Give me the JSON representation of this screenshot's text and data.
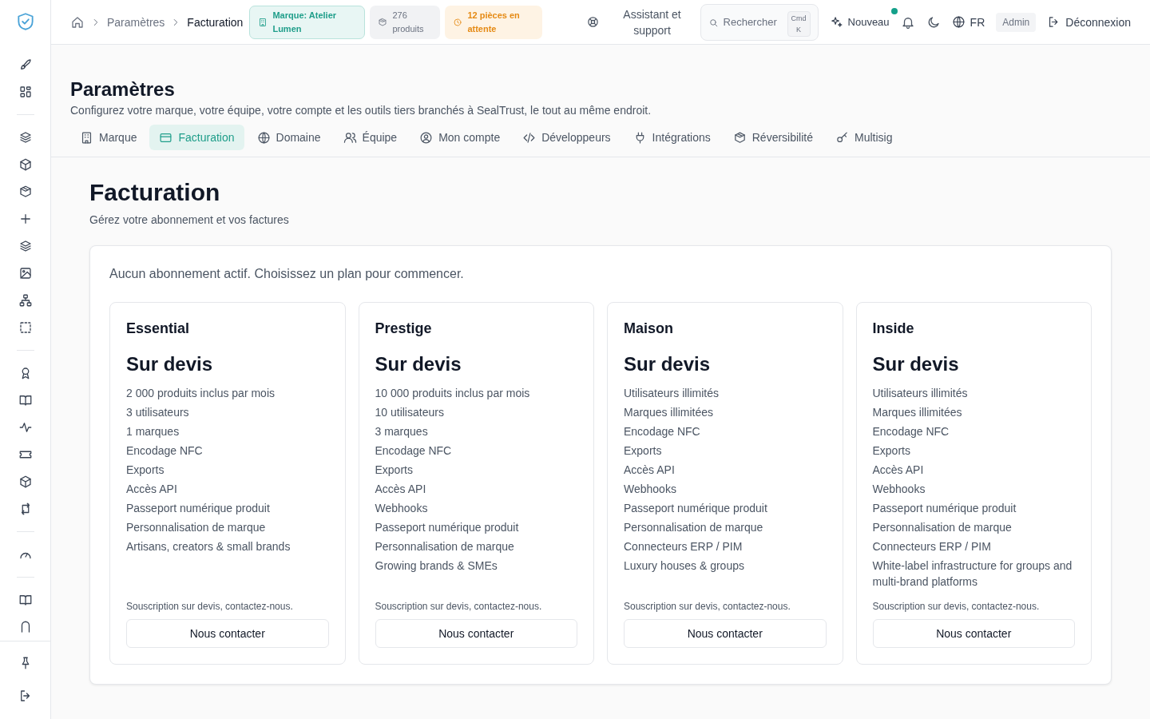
{
  "topbar": {
    "breadcrumbs": [
      "Paramètres",
      "Facturation"
    ],
    "badges": [
      {
        "kind": "brand",
        "text": "Marque: Atelier Lumen"
      },
      {
        "kind": "count",
        "text": "276 produits"
      },
      {
        "kind": "pending",
        "text": "12 pièces en attente"
      }
    ],
    "help": "Assistant et support",
    "search": {
      "placeholder": "Rechercher",
      "shortcut": [
        "Cmd",
        "K"
      ]
    },
    "new_button": {
      "label": "Nouveau",
      "has_update": true
    },
    "language": "FR",
    "role": "Admin",
    "logout": "Déconnexion"
  },
  "page": {
    "title": "Paramètres",
    "subtitle": "Configurez votre marque, votre équipe, votre compte et les outils tiers branchés à SealTrust, le tout au même endroit.",
    "tabs": [
      {
        "label": "Marque",
        "selected": false
      },
      {
        "label": "Facturation",
        "selected": true
      },
      {
        "label": "Domaine",
        "selected": false
      },
      {
        "label": "Équipe",
        "selected": false
      },
      {
        "label": "Mon compte",
        "selected": false
      },
      {
        "label": "Développeurs",
        "selected": false
      },
      {
        "label": "Intégrations",
        "selected": false
      },
      {
        "label": "Réversibilité",
        "selected": false
      },
      {
        "label": "Multisig",
        "selected": false
      }
    ]
  },
  "billing": {
    "title": "Facturation",
    "subtitle": "Gérez votre abonnement et vos factures",
    "notice": "Aucun abonnement actif. Choisissez un plan pour commencer.",
    "plans": [
      {
        "name": "Essential",
        "price": "Sur devis",
        "features": [
          "2 000 produits inclus par mois",
          "3 utilisateurs",
          "1 marques",
          "Encodage NFC",
          "Exports",
          "Accès API",
          "Passeport numérique produit",
          "Personnalisation de marque",
          "Artisans, creators & small brands"
        ],
        "note": "Souscription sur devis, contactez-nous.",
        "button": "Nous contacter"
      },
      {
        "name": "Prestige",
        "price": "Sur devis",
        "features": [
          "10 000 produits inclus par mois",
          "10 utilisateurs",
          "3 marques",
          "Encodage NFC",
          "Exports",
          "Accès API",
          "Webhooks",
          "Passeport numérique produit",
          "Personnalisation de marque",
          "Growing brands & SMEs"
        ],
        "note": "Souscription sur devis, contactez-nous.",
        "button": "Nous contacter"
      },
      {
        "name": "Maison",
        "price": "Sur devis",
        "features": [
          "Utilisateurs illimités",
          "Marques illimitées",
          "Encodage NFC",
          "Exports",
          "Accès API",
          "Webhooks",
          "Passeport numérique produit",
          "Personnalisation de marque",
          "Connecteurs ERP / PIM",
          "Luxury houses & groups"
        ],
        "note": "Souscription sur devis, contactez-nous.",
        "button": "Nous contacter"
      },
      {
        "name": "Inside",
        "price": "Sur devis",
        "features": [
          "Utilisateurs illimités",
          "Marques illimitées",
          "Encodage NFC",
          "Exports",
          "Accès API",
          "Webhooks",
          "Passeport numérique produit",
          "Personnalisation de marque",
          "Connecteurs ERP / PIM",
          "White-label infrastructure for groups and multi-brand platforms"
        ],
        "note": "Souscription sur devis, contactez-nous.",
        "button": "Nous contacter"
      }
    ]
  }
}
